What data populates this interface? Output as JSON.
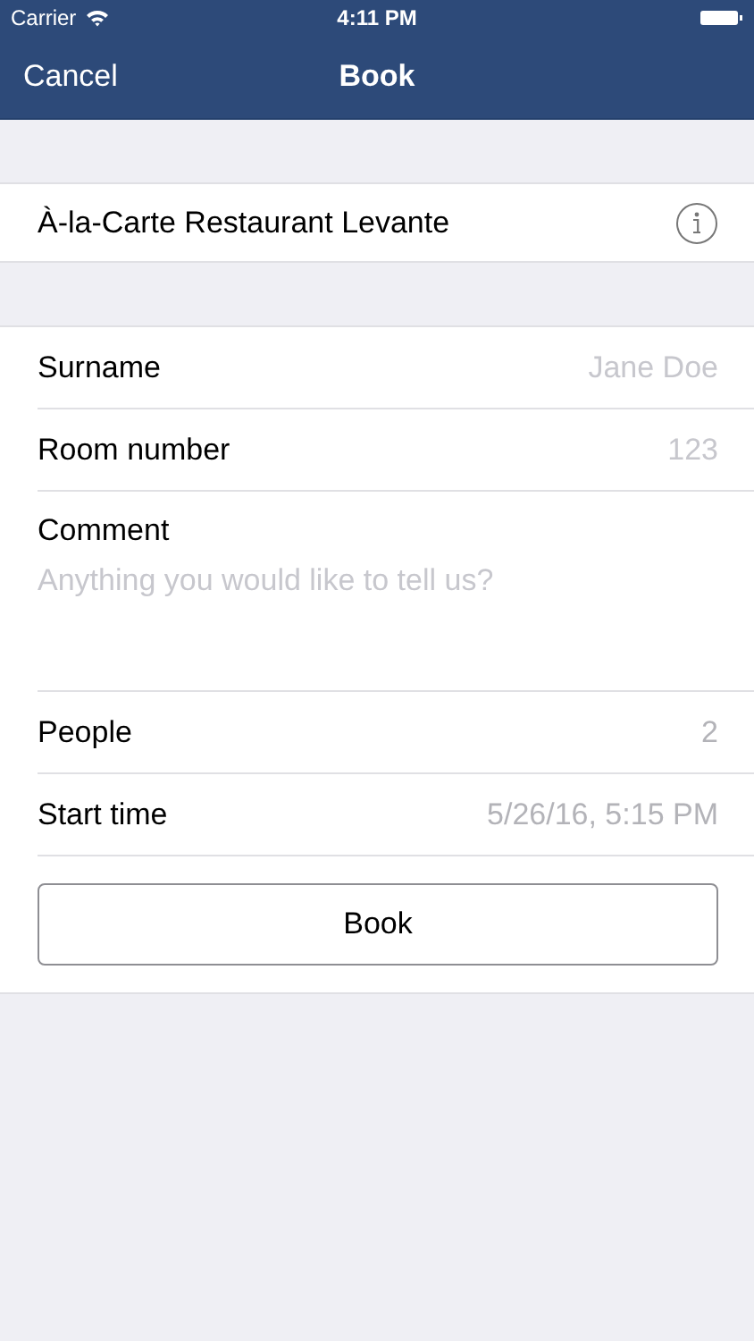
{
  "status_bar": {
    "carrier": "Carrier",
    "time": "4:11 PM"
  },
  "nav": {
    "left": "Cancel",
    "title": "Book"
  },
  "restaurant": {
    "name": "À-la-Carte Restaurant Levante"
  },
  "fields": [
    {
      "kind": "text",
      "label": "Surname",
      "placeholder": "Jane Doe"
    },
    {
      "kind": "text",
      "label": "Room number",
      "placeholder": "123"
    },
    {
      "kind": "textarea",
      "label": "Comment",
      "placeholder": "Anything you would like to tell us?"
    },
    {
      "kind": "picker",
      "label": "People",
      "value": "2"
    },
    {
      "kind": "picker",
      "label": "Start time",
      "value": "5/26/16, 5:15 PM"
    }
  ],
  "submit": "Book"
}
